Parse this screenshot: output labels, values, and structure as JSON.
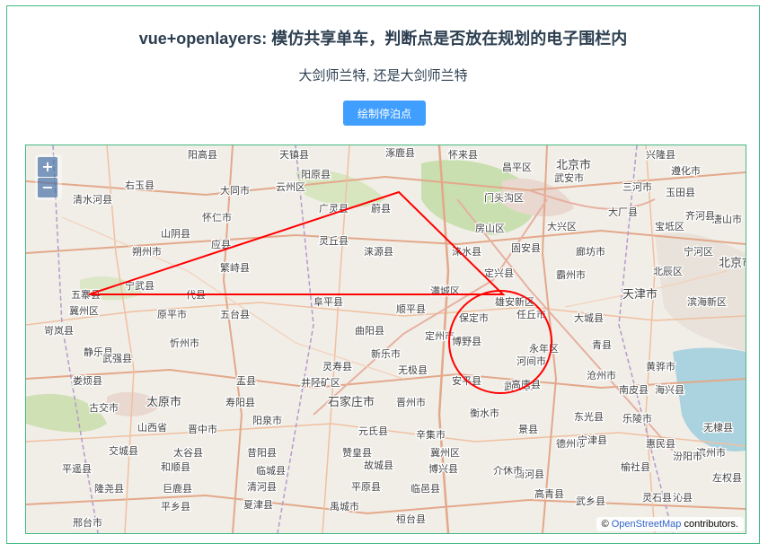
{
  "header": {
    "title": "vue+openlayers: 模仿共享单车，判断点是否放在规划的电子围栏内",
    "subtitle": "大剑师兰特, 还是大剑师兰特",
    "button_label": "绘制停泊点"
  },
  "map": {
    "zoom_in": "+",
    "zoom_out": "−",
    "attribution_prefix": "© ",
    "attribution_link": "OpenStreetMap",
    "attribution_suffix": " contributors.",
    "fence_color": "#ff0000",
    "labels": [
      {
        "text": "阳高县"
      },
      {
        "text": "天镇县"
      },
      {
        "text": "涿鹿县"
      },
      {
        "text": "怀来县"
      },
      {
        "text": "昌平区"
      },
      {
        "text": "北京市"
      },
      {
        "text": "兴隆县"
      },
      {
        "text": "右玉县"
      },
      {
        "text": "大同市"
      },
      {
        "text": "云州区"
      },
      {
        "text": "阳原县"
      },
      {
        "text": "门头沟区"
      },
      {
        "text": "三河市"
      },
      {
        "text": "遵化市"
      },
      {
        "text": "清水河县"
      },
      {
        "text": "怀仁市"
      },
      {
        "text": "广灵县"
      },
      {
        "text": "蔚县"
      },
      {
        "text": "房山区"
      },
      {
        "text": "大兴区"
      },
      {
        "text": "大厂县"
      },
      {
        "text": "玉田县"
      },
      {
        "text": "山阴县"
      },
      {
        "text": "宝坻区"
      },
      {
        "text": "唐山市"
      },
      {
        "text": "朔州市"
      },
      {
        "text": "应县"
      },
      {
        "text": "灵丘县"
      },
      {
        "text": "涞源县"
      },
      {
        "text": "涞水县"
      },
      {
        "text": "固安县"
      },
      {
        "text": "廊坊市"
      },
      {
        "text": "天津市"
      },
      {
        "text": "宁河区"
      },
      {
        "text": "繁峙县"
      },
      {
        "text": "定兴县"
      },
      {
        "text": "霸州市"
      },
      {
        "text": "北辰区"
      },
      {
        "text": "宁武县"
      },
      {
        "text": "代县"
      },
      {
        "text": "满城区"
      },
      {
        "text": "五寨县"
      },
      {
        "text": "阜平县"
      },
      {
        "text": "雄安新区"
      },
      {
        "text": "滨海新区"
      },
      {
        "text": "原平市"
      },
      {
        "text": "五台县"
      },
      {
        "text": "顺平县"
      },
      {
        "text": "保定市"
      },
      {
        "text": "任丘市"
      },
      {
        "text": "大城县"
      },
      {
        "text": "岢岚县"
      },
      {
        "text": "曲阳县"
      },
      {
        "text": "定州市"
      },
      {
        "text": "博野县"
      },
      {
        "text": "青县"
      },
      {
        "text": "静乐县"
      },
      {
        "text": "忻州市"
      },
      {
        "text": "新乐市"
      },
      {
        "text": "河间市"
      },
      {
        "text": "黄骅市"
      },
      {
        "text": "灵寿县"
      },
      {
        "text": "无极县"
      },
      {
        "text": "沧州市"
      },
      {
        "text": "娄烦县"
      },
      {
        "text": "盂县"
      },
      {
        "text": "井陉矿区"
      },
      {
        "text": "安平县"
      },
      {
        "text": "武强县"
      },
      {
        "text": "南皮县"
      },
      {
        "text": "海兴县"
      },
      {
        "text": "太原市"
      },
      {
        "text": "寿阳县"
      },
      {
        "text": "石家庄市"
      },
      {
        "text": "晋州市"
      },
      {
        "text": "衡水市"
      },
      {
        "text": "古交市"
      },
      {
        "text": "阳泉市"
      },
      {
        "text": "东光县"
      },
      {
        "text": "乐陵市"
      },
      {
        "text": "无棣县"
      },
      {
        "text": "山西省"
      },
      {
        "text": "晋中市"
      },
      {
        "text": "元氏县"
      },
      {
        "text": "辛集市"
      },
      {
        "text": "景县"
      },
      {
        "text": "德州市"
      },
      {
        "text": "宁津县"
      },
      {
        "text": "惠民县"
      },
      {
        "text": "滨州市"
      },
      {
        "text": "交城县"
      },
      {
        "text": "太谷县"
      },
      {
        "text": "昔阳县"
      },
      {
        "text": "赞皇县"
      },
      {
        "text": "冀州区"
      },
      {
        "text": "商河县"
      },
      {
        "text": "汾阳市"
      },
      {
        "text": "平遥县"
      },
      {
        "text": "和顺县"
      },
      {
        "text": "临城县"
      },
      {
        "text": "故城县"
      },
      {
        "text": "博兴县"
      },
      {
        "text": "介休市"
      },
      {
        "text": "榆社县"
      },
      {
        "text": "隆尧县"
      },
      {
        "text": "巨鹿县"
      },
      {
        "text": "清河县"
      },
      {
        "text": "平原县"
      },
      {
        "text": "临邑县"
      },
      {
        "text": "高青县"
      },
      {
        "text": "武乡县"
      },
      {
        "text": "左权县"
      },
      {
        "text": "邢台市"
      },
      {
        "text": "平乡县"
      },
      {
        "text": "夏津县"
      },
      {
        "text": "禹城市"
      },
      {
        "text": "桓台县"
      },
      {
        "text": "灵石县"
      },
      {
        "text": "沁县"
      },
      {
        "text": "武安市"
      },
      {
        "text": "永年区"
      },
      {
        "text": "高唐县"
      },
      {
        "text": "齐河县"
      },
      {
        "text": "北京市"
      },
      {
        "text": "冀州区"
      },
      {
        "text": "武强县"
      }
    ]
  }
}
